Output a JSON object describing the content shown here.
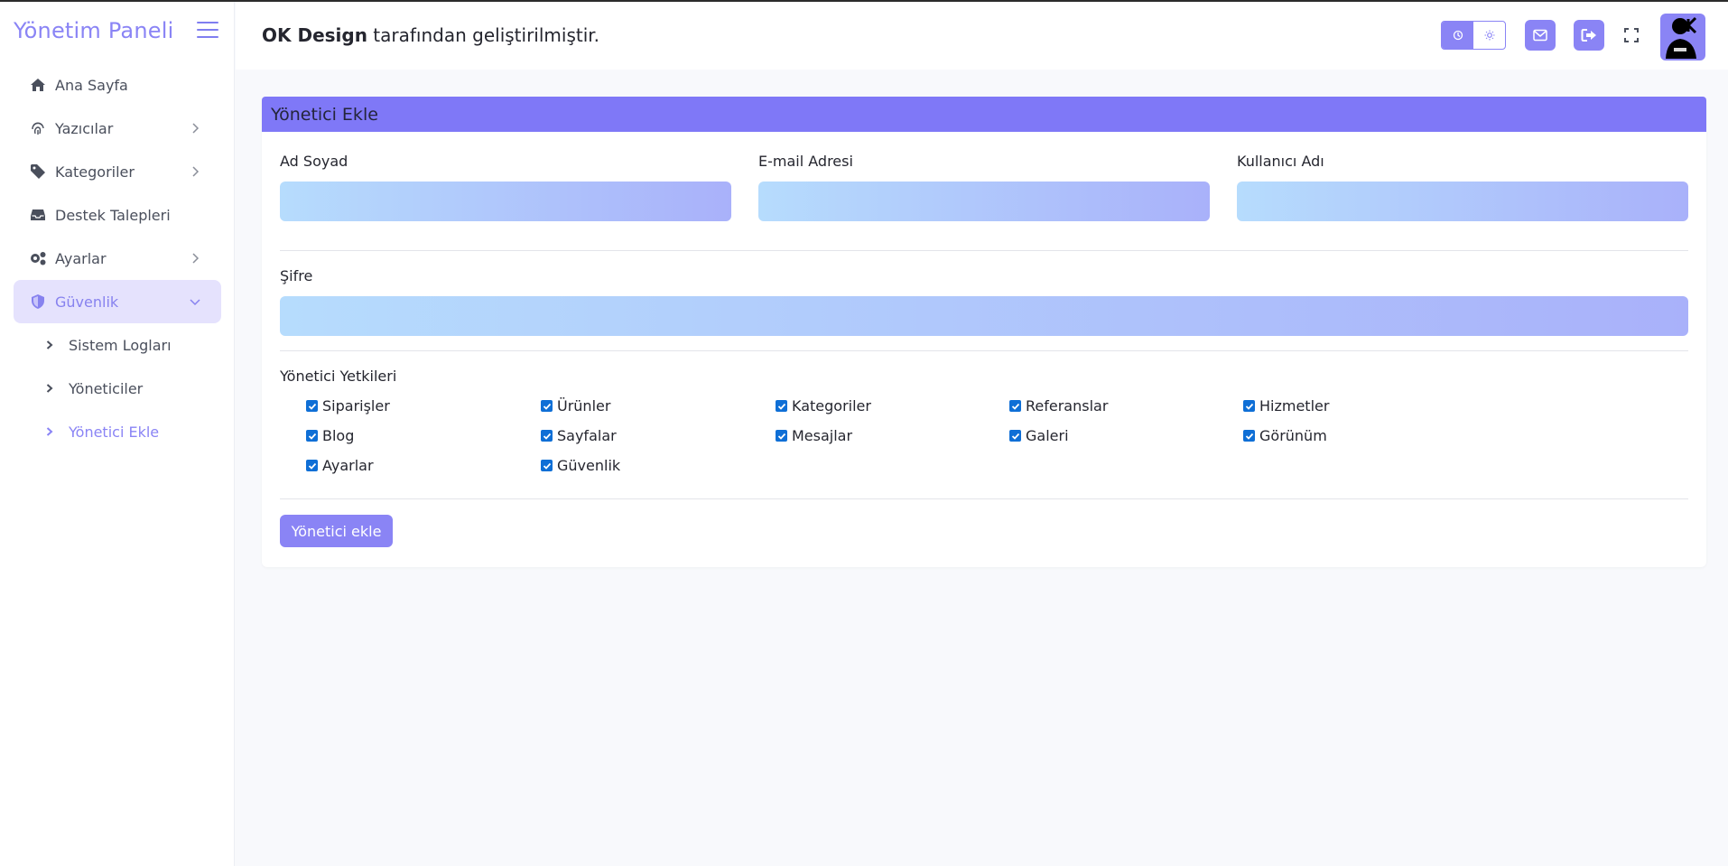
{
  "sidebar": {
    "brand": "Yönetim Paneli",
    "items": [
      {
        "label": "Ana Sayfa"
      },
      {
        "label": "Yazıcılar"
      },
      {
        "label": "Kategoriler"
      },
      {
        "label": "Destek Talepleri"
      },
      {
        "label": "Ayarlar"
      },
      {
        "label": "Güvenlik"
      }
    ],
    "security_sub": [
      {
        "label": "Sistem Logları"
      },
      {
        "label": "Yöneticiler"
      },
      {
        "label": "Yönetici Ekle"
      }
    ]
  },
  "header": {
    "credit_brand": "OK Design",
    "credit_rest": " tarafından geliştirilmiştir."
  },
  "form": {
    "title": "Yönetici Ekle",
    "name_label": "Ad Soyad",
    "email_label": "E-mail Adresi",
    "username_label": "Kullanıcı Adı",
    "password_label": "Şifre",
    "name_value": "",
    "email_value": "",
    "username_value": "",
    "password_value": "",
    "permissions_title": "Yönetici Yetkileri",
    "permissions": [
      {
        "label": "Siparişler",
        "checked": true
      },
      {
        "label": "Ürünler",
        "checked": true
      },
      {
        "label": "Kategoriler",
        "checked": true
      },
      {
        "label": "Referanslar",
        "checked": true
      },
      {
        "label": "Hizmetler",
        "checked": true
      },
      {
        "label": "Blog",
        "checked": true
      },
      {
        "label": "Sayfalar",
        "checked": true
      },
      {
        "label": "Mesajlar",
        "checked": true
      },
      {
        "label": "Galeri",
        "checked": true
      },
      {
        "label": "Görünüm",
        "checked": true
      },
      {
        "label": "Ayarlar",
        "checked": true
      },
      {
        "label": "Güvenlik",
        "checked": true
      }
    ],
    "submit_label": "Yönetici ekle"
  },
  "colors": {
    "accent": "#8a84f5",
    "card_header": "#7f78f7",
    "active_nav_bg": "#e5e2fd",
    "checkbox": "#0f6fd6"
  }
}
